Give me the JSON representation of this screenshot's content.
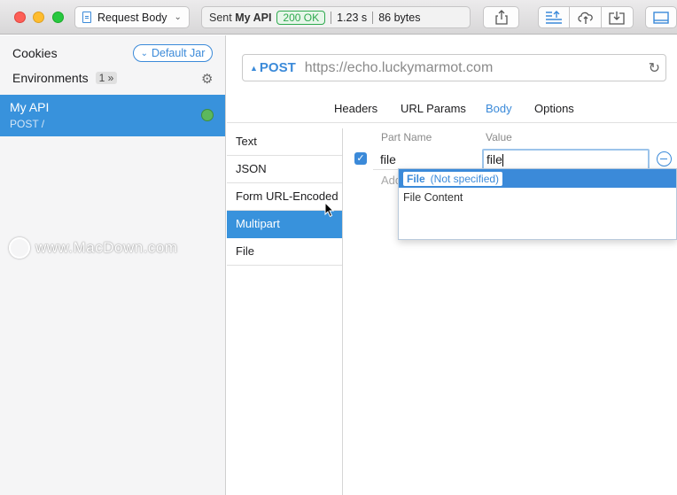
{
  "toolbar": {
    "request_body_label": "Request Body",
    "status_sent_prefix": "Sent",
    "status_api_name": "My API",
    "status_code": "200 OK",
    "status_time": "1.23 s",
    "status_size": "86 bytes"
  },
  "sidebar": {
    "cookies_label": "Cookies",
    "default_jar_label": "Default Jar",
    "environments_label": "Environments",
    "environments_count": "1",
    "items": [
      {
        "name": "My API",
        "subtitle": "POST /",
        "status_color": "#5cb85c"
      }
    ],
    "watermark": "www.MacDown.com"
  },
  "request": {
    "method": "POST",
    "url": "https://echo.luckymarmot.com"
  },
  "tabs": [
    "Headers",
    "URL Params",
    "Body",
    "Options"
  ],
  "active_tab": "Body",
  "body_types": [
    "Text",
    "JSON",
    "Form URL-Encoded",
    "Multipart",
    "File"
  ],
  "selected_body_type": "Multipart",
  "parts": {
    "col_name": "Part Name",
    "col_value": "Value",
    "rows": [
      {
        "checked": true,
        "name": "file",
        "value": "file"
      }
    ],
    "add_hint": "Add"
  },
  "dropdown": {
    "selected_label": "File",
    "selected_detail": "(Not specified)",
    "items": [
      "File Content"
    ]
  },
  "colors": {
    "accent": "#3b8ad9",
    "selection": "#3892dc",
    "ok_green": "#2ea94e"
  }
}
